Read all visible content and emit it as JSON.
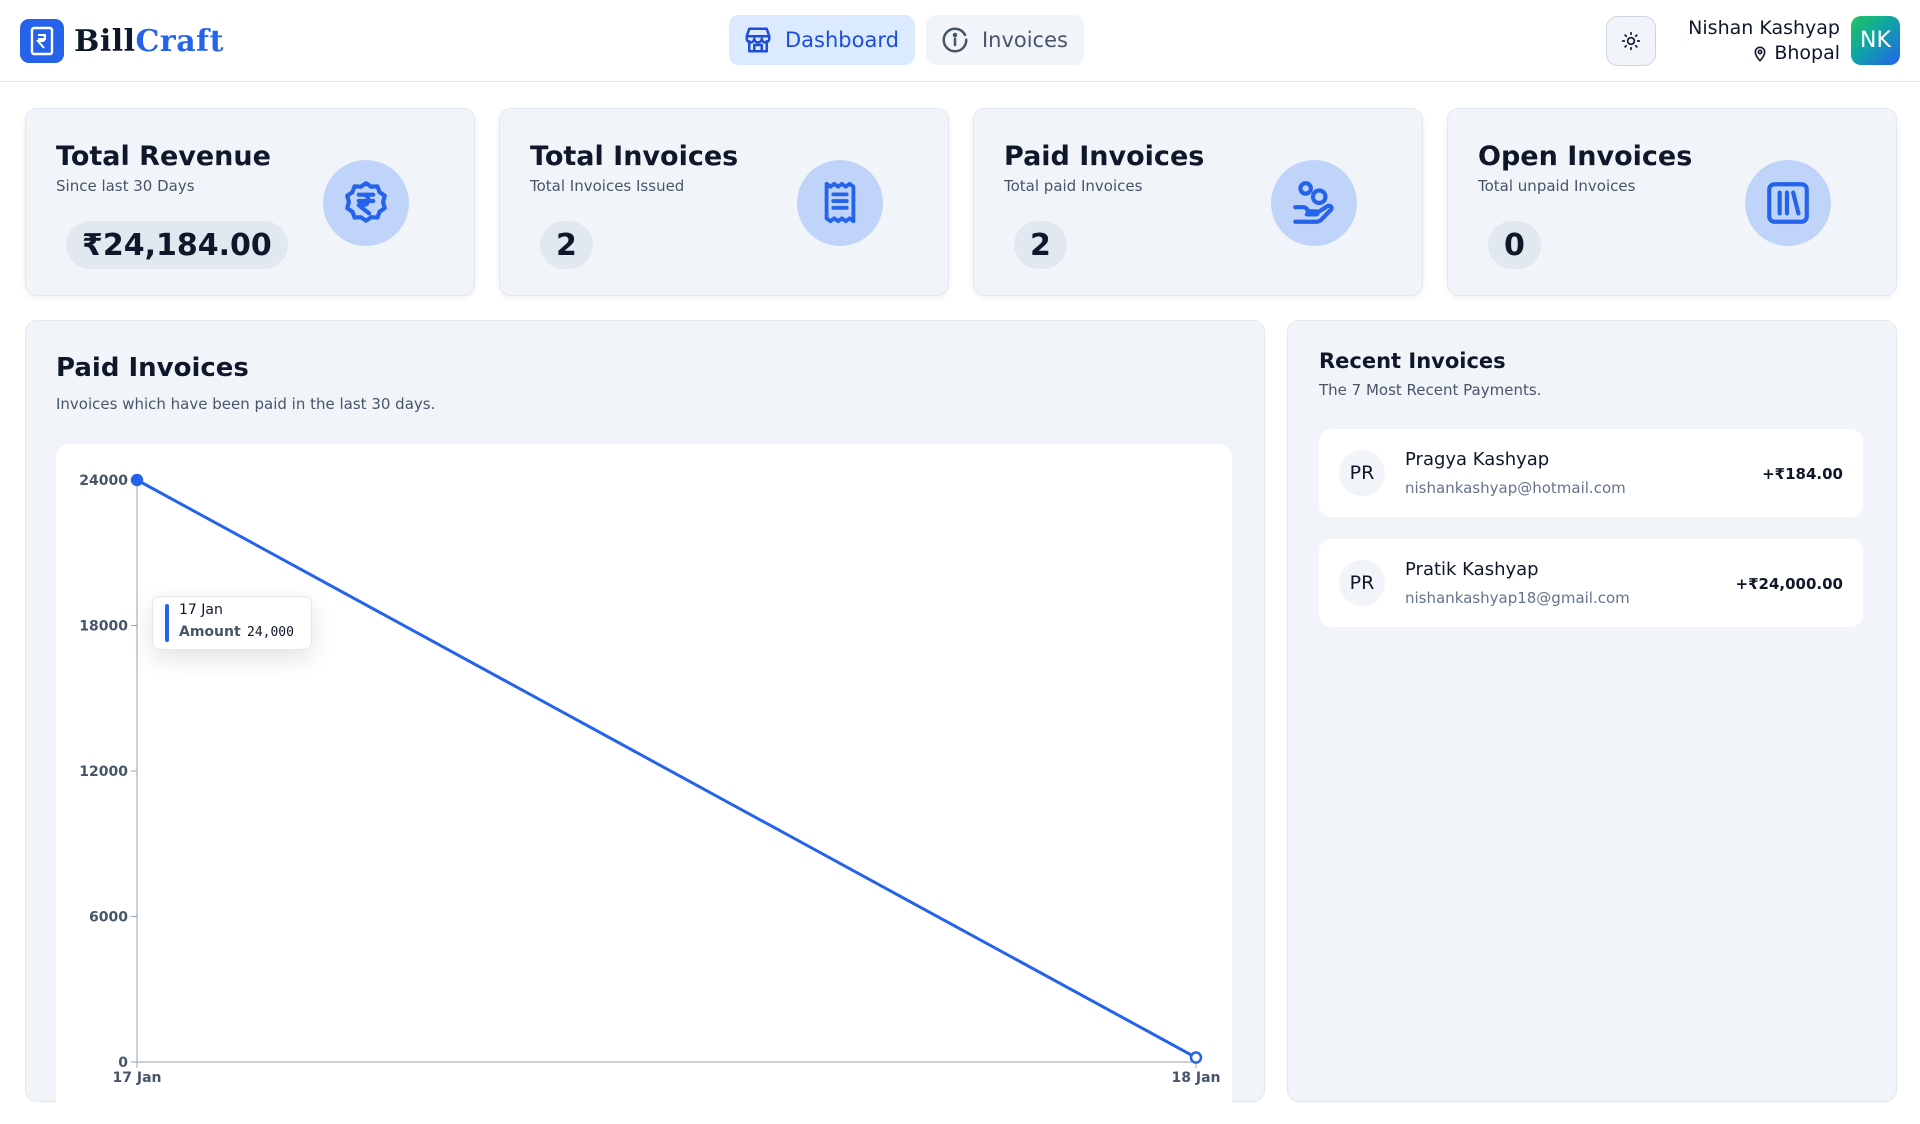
{
  "brand": {
    "part1": "Bill",
    "part2": "Craft"
  },
  "nav": [
    {
      "label": "Dashboard",
      "active": true,
      "icon": "store-icon"
    },
    {
      "label": "Invoices",
      "active": false,
      "icon": "info-icon"
    }
  ],
  "user": {
    "name": "Nishan Kashyap",
    "location": "Bhopal",
    "initials": "NK"
  },
  "cards": [
    {
      "title": "Total Revenue",
      "subtitle": "Since last 30 Days",
      "value": "₹24,184.00",
      "icon": "rupee-badge-icon"
    },
    {
      "title": "Total Invoices",
      "subtitle": "Total Invoices Issued",
      "value": "2",
      "icon": "receipt-icon"
    },
    {
      "title": "Paid Invoices",
      "subtitle": "Total paid Invoices",
      "value": "2",
      "icon": "hand-coins-icon"
    },
    {
      "title": "Open Invoices",
      "subtitle": "Total unpaid Invoices",
      "value": "0",
      "icon": "library-icon"
    }
  ],
  "chart_panel": {
    "title": "Paid Invoices",
    "subtitle": "Invoices which have been paid in the last 30 days."
  },
  "chart_data": {
    "type": "line",
    "x": [
      "17 Jan",
      "18 Jan"
    ],
    "series": [
      {
        "name": "Amount",
        "values": [
          24000,
          184
        ]
      }
    ],
    "yticks": [
      "0",
      "6000",
      "12000",
      "18000",
      "24000"
    ],
    "ylim": [
      0,
      24000
    ],
    "grid": false,
    "color": "#2563eb"
  },
  "tooltip": {
    "date": "17 Jan",
    "label": "Amount",
    "value": "24,000"
  },
  "recent": {
    "title": "Recent Invoices",
    "subtitle": "The 7 Most Recent Payments.",
    "items": [
      {
        "initials": "PR",
        "name": "Pragya Kashyap",
        "email": "nishankashyap@hotmail.com",
        "amount": "+₹184.00"
      },
      {
        "initials": "PR",
        "name": "Pratik Kashyap",
        "email": "nishankashyap18@gmail.com",
        "amount": "+₹24,000.00"
      }
    ]
  },
  "colors": {
    "accent": "#2563eb",
    "accent_soft": "#bfd4f8",
    "panel": "#f1f5f9"
  }
}
